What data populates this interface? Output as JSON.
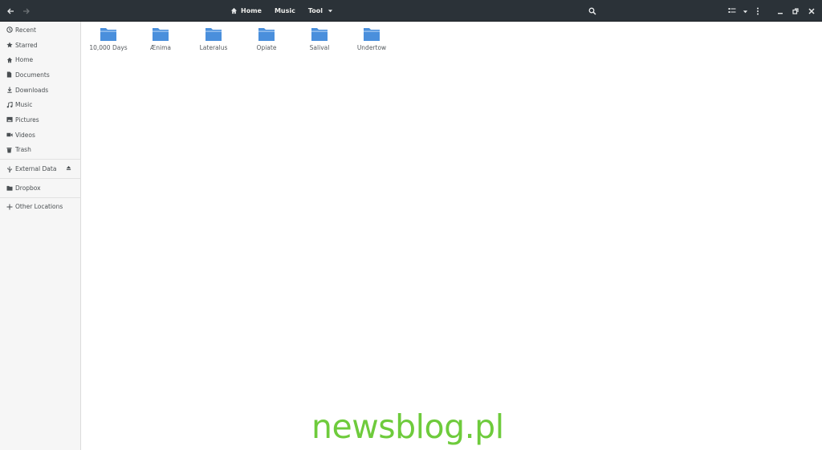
{
  "header": {
    "path": [
      {
        "label": "Home",
        "icon": "home-icon"
      },
      {
        "label": "Music"
      },
      {
        "label": "Tool",
        "icon": "chevron-down-icon"
      }
    ]
  },
  "sidebar": {
    "items": [
      {
        "label": "Recent",
        "icon": "clock-icon"
      },
      {
        "label": "Starred",
        "icon": "star-icon"
      },
      {
        "label": "Home",
        "icon": "home-icon"
      },
      {
        "label": "Documents",
        "icon": "document-icon"
      },
      {
        "label": "Downloads",
        "icon": "download-icon"
      },
      {
        "label": "Music",
        "icon": "music-note-icon"
      },
      {
        "label": "Pictures",
        "icon": "picture-icon"
      },
      {
        "label": "Videos",
        "icon": "video-icon"
      },
      {
        "label": "Trash",
        "icon": "trash-icon"
      }
    ],
    "devices": [
      {
        "label": "External Data",
        "icon": "usb-icon"
      }
    ],
    "bookmarks": [
      {
        "label": "Dropbox",
        "icon": "folder-icon"
      }
    ],
    "other": {
      "label": "Other Locations",
      "icon": "plus-icon"
    }
  },
  "folders": [
    {
      "label": "10,000 Days"
    },
    {
      "label": "Ænima"
    },
    {
      "label": "Lateralus"
    },
    {
      "label": "Opiate"
    },
    {
      "label": "Salival"
    },
    {
      "label": "Undertow"
    }
  ],
  "watermark": "newsblog.pl",
  "colors": {
    "header_bg": "#2b3238",
    "folder_blue": "#4a8fdc",
    "watermark": "#6ecb3c"
  }
}
